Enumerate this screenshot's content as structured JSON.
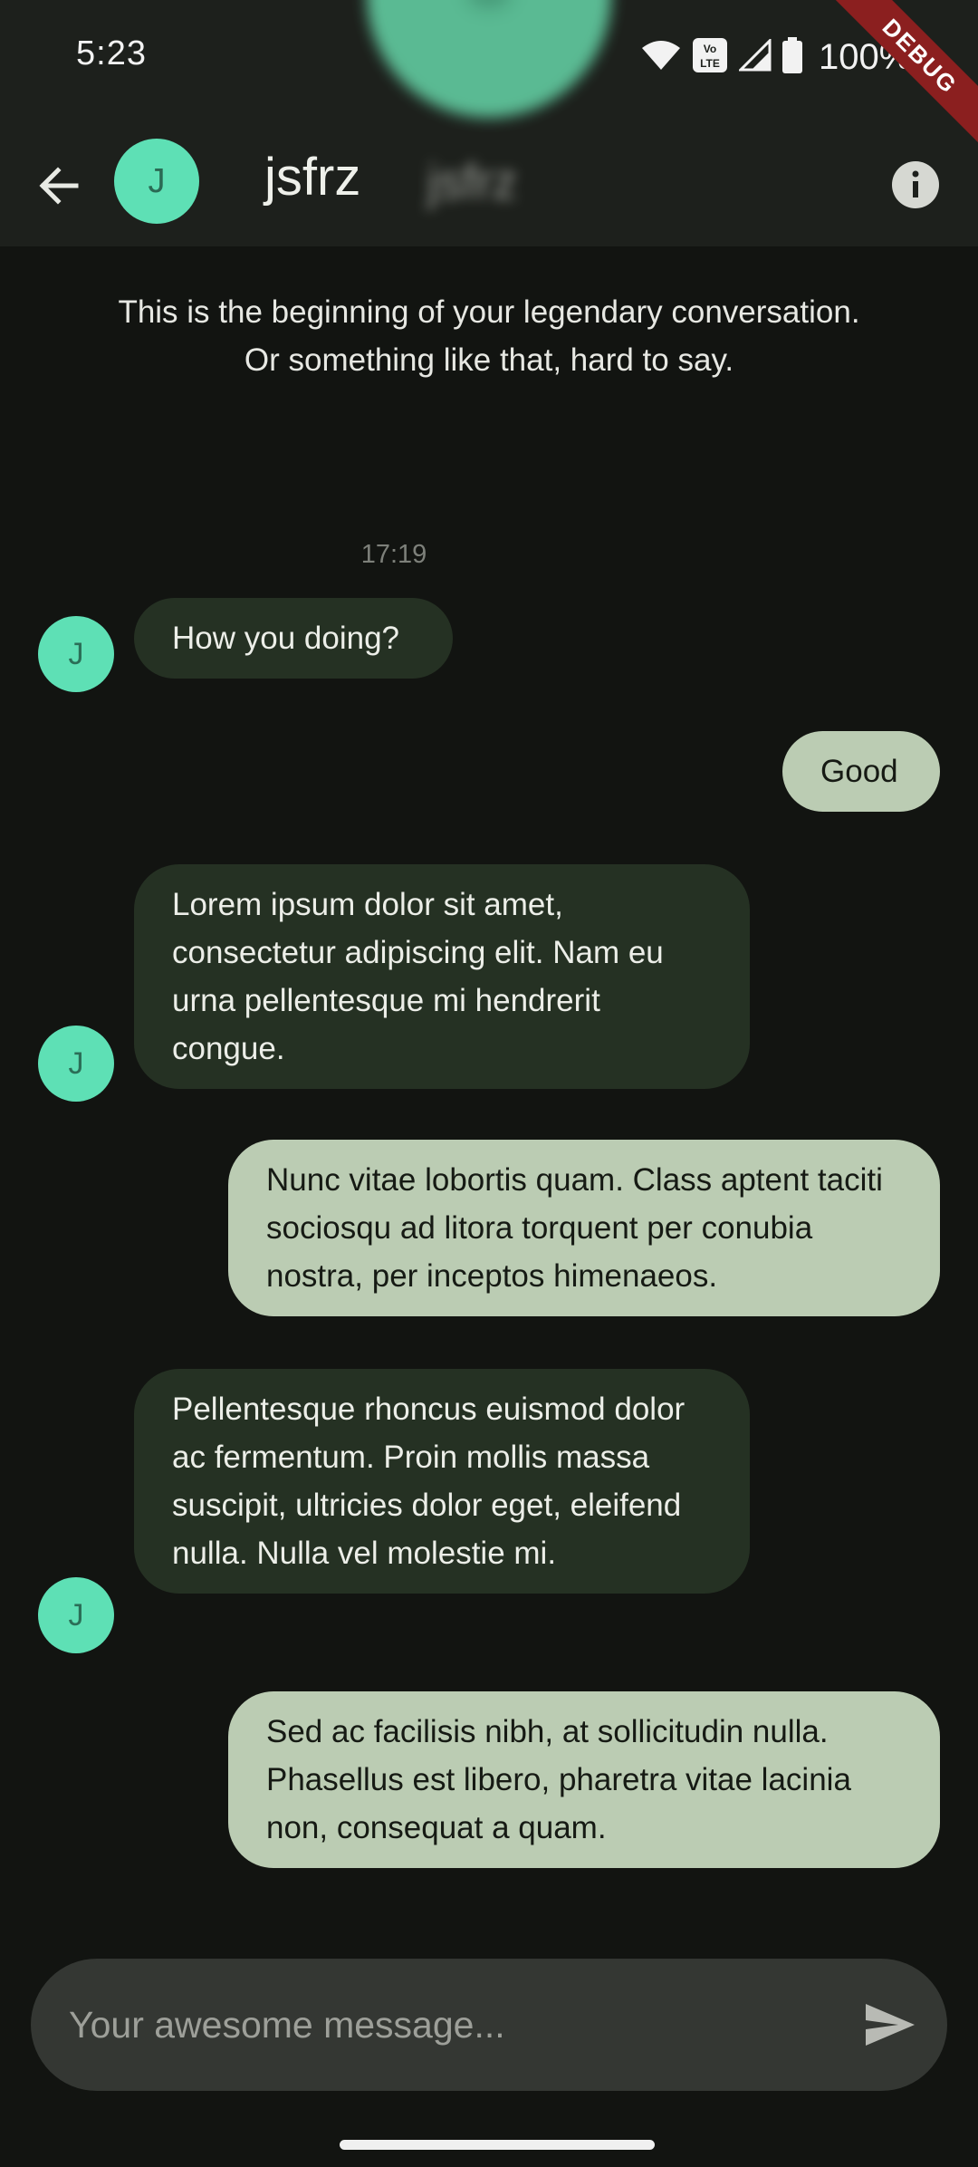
{
  "status_bar": {
    "time": "5:23",
    "battery": "100%",
    "debug_label": "DEBUG",
    "volte_label": "Vo\nLTE"
  },
  "header": {
    "avatar_initial": "J",
    "name": "jsfrz",
    "blurred_name": "jsfrz"
  },
  "conversation": {
    "intro": "This is the beginning of your legendary conversation. Or something like that, hard to say.",
    "timestamp": "17:19",
    "messages": [
      {
        "direction": "in",
        "avatar": "J",
        "text": "How you doing?"
      },
      {
        "direction": "out",
        "text": "Good"
      },
      {
        "direction": "in",
        "avatar": "J",
        "text": "Lorem ipsum dolor sit amet, consectetur adipiscing elit. Nam eu urna pellentesque mi hendrerit congue."
      },
      {
        "direction": "out",
        "text": "Nunc vitae lobortis quam. Class aptent taciti sociosqu ad litora torquent per conubia nostra, per inceptos himenaeos."
      },
      {
        "direction": "in",
        "avatar": "J",
        "text": "Pellentesque rhoncus euismod dolor ac fermentum. Proin mollis massa suscipit, ultricies dolor eget, eleifend nulla. Nulla vel molestie mi."
      },
      {
        "direction": "out",
        "text": "Sed ac facilisis nibh, at sollicitudin nulla. Phasellus est libero, pharetra vitae lacinia non, consequat a quam."
      }
    ]
  },
  "composer": {
    "placeholder": "Your awesome message..."
  },
  "icons": [
    "back-arrow-icon",
    "info-icon",
    "send-icon",
    "wifi-icon",
    "signal-icon",
    "battery-icon",
    "volte-icon"
  ],
  "colors": {
    "avatar": "#5ee0b5",
    "incoming_bubble": "#253123",
    "outgoing_bubble": "#bbccb3",
    "background": "#121411"
  }
}
